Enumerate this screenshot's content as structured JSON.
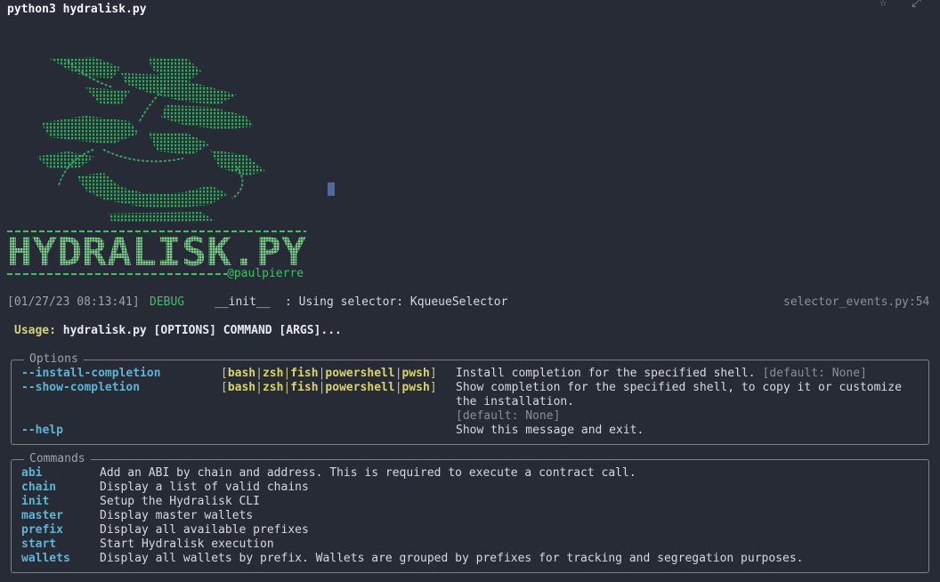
{
  "window": {
    "title": "python3 hydralisk.py"
  },
  "banner": {
    "logo_text": "HYDRALISK.PY",
    "handle": "@paulpierre"
  },
  "log": {
    "timestamp": "[01/27/23 08:13:41]",
    "level": "DEBUG",
    "module": "__init__",
    "message": ": Using selector: KqueueSelector",
    "source": "selector_events.py:54"
  },
  "usage": {
    "label": "Usage:",
    "command": "hydralisk.py [OPTIONS] COMMAND [ARGS]..."
  },
  "options": {
    "title": "Options",
    "items": [
      {
        "flag": "--install-completion",
        "choices": [
          "bash",
          "zsh",
          "fish",
          "powershell",
          "pwsh"
        ],
        "desc_lines": [
          "Install completion for the specified shell."
        ],
        "default": "[default: None]",
        "default_inline": true
      },
      {
        "flag": "--show-completion",
        "choices": [
          "bash",
          "zsh",
          "fish",
          "powershell",
          "pwsh"
        ],
        "desc_lines": [
          "Show completion for the specified shell, to copy it or customize",
          "the installation."
        ],
        "default": "[default: None]",
        "default_inline": false
      },
      {
        "flag": "--help",
        "choices": [],
        "desc_lines": [
          "Show this message and exit."
        ],
        "default": "",
        "default_inline": false
      }
    ]
  },
  "commands": {
    "title": "Commands",
    "items": [
      {
        "name": "abi",
        "desc": "Add an ABI by chain and address. This is required to execute a contract call."
      },
      {
        "name": "chain",
        "desc": "Display a list of valid chains"
      },
      {
        "name": "init",
        "desc": "Setup the Hydralisk CLI"
      },
      {
        "name": "master",
        "desc": "Display master wallets"
      },
      {
        "name": "prefix",
        "desc": "Display all available prefixes"
      },
      {
        "name": "start",
        "desc": "Start Hydralisk execution"
      },
      {
        "name": "wallets",
        "desc": "Display all wallets by prefix. Wallets are grouped by prefixes for tracking and segregation purposes."
      }
    ]
  },
  "colors": {
    "background": "#272b36",
    "accent_green": "#3fbf6a",
    "option_blue": "#5fb4d1",
    "choice_yellow": "#cfc86a"
  }
}
